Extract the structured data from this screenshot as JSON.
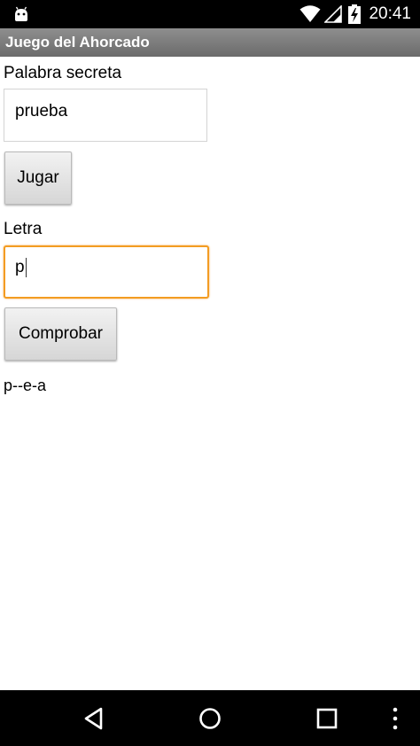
{
  "status_bar": {
    "time": "20:41",
    "icons": [
      "android-debug-icon",
      "wifi-icon",
      "signal-icon",
      "battery-charging-icon"
    ]
  },
  "app": {
    "title": "Juego del Ahorcado"
  },
  "form": {
    "secret_label": "Palabra secreta",
    "secret_value": "prueba",
    "play_button": "Jugar",
    "letter_label": "Letra",
    "letter_value": "p",
    "check_button": "Comprobar",
    "result_text": "p--e-a"
  },
  "nav_bar": {
    "buttons": [
      "back-icon",
      "home-icon",
      "recents-icon",
      "overflow-menu-icon"
    ]
  },
  "colors": {
    "status_bar": "#000000",
    "title_bar": "#7a7a7a",
    "focus_border": "#f39c22",
    "background": "#ffffff"
  }
}
